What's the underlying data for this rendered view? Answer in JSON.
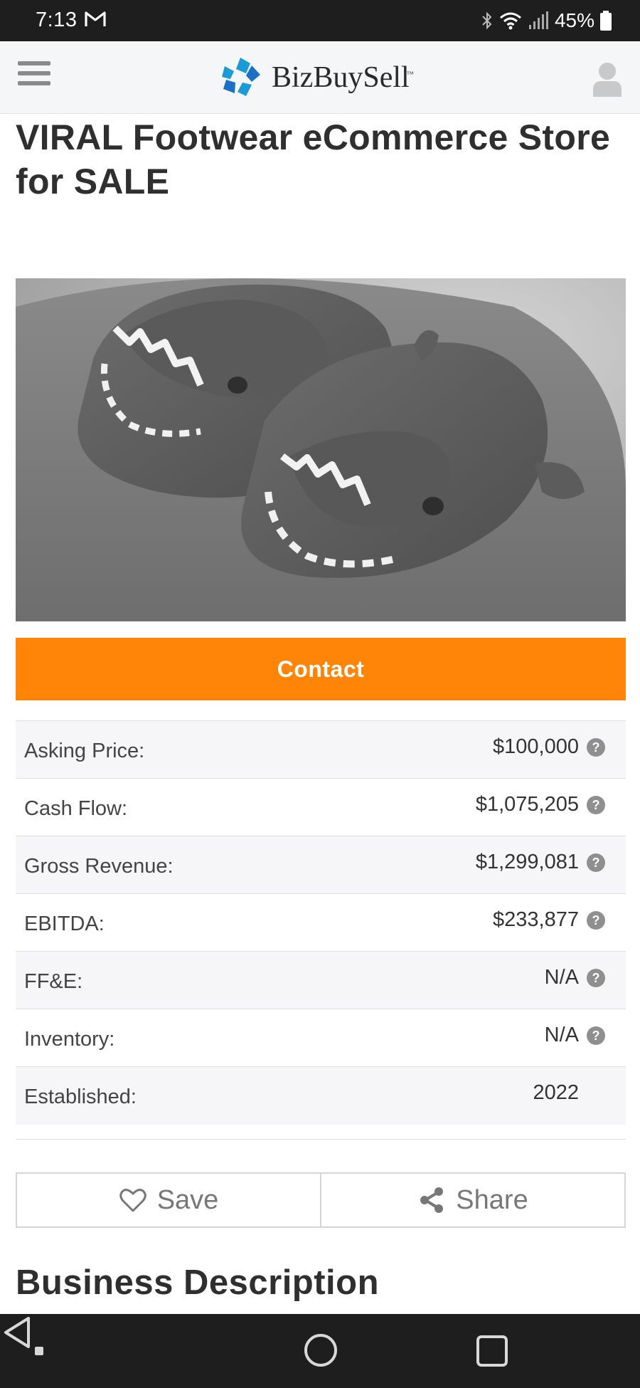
{
  "status_bar": {
    "time": "7:13",
    "battery": "45%"
  },
  "header": {
    "brand": "BizBuySell",
    "brand_tm": "™",
    "brand_colors": [
      "#1a9ad6",
      "#1b6fc7"
    ]
  },
  "listing": {
    "title": "VIRAL Footwear eCommerce Store for SALE",
    "contact_label": "Contact",
    "accent_color": "#ff8508",
    "financials": [
      {
        "label": "Asking Price:",
        "value": "$100,000",
        "help": true
      },
      {
        "label": "Cash Flow:",
        "value": "$1,075,205",
        "help": true
      },
      {
        "label": "Gross Revenue:",
        "value": "$1,299,081",
        "help": true
      },
      {
        "label": "EBITDA:",
        "value": "$233,877",
        "help": true
      },
      {
        "label": "FF&E:",
        "value": "N/A",
        "help": true
      },
      {
        "label": "Inventory:",
        "value": "N/A",
        "help": true
      },
      {
        "label": "Established:",
        "value": "2022",
        "help": false
      }
    ],
    "save_label": "Save",
    "share_label": "Share",
    "section_title": "Business Description"
  },
  "icons": {
    "menu": "hamburger-icon",
    "account": "user-icon",
    "help": "question-circle-icon",
    "save": "heart-icon",
    "share": "share-icon"
  }
}
